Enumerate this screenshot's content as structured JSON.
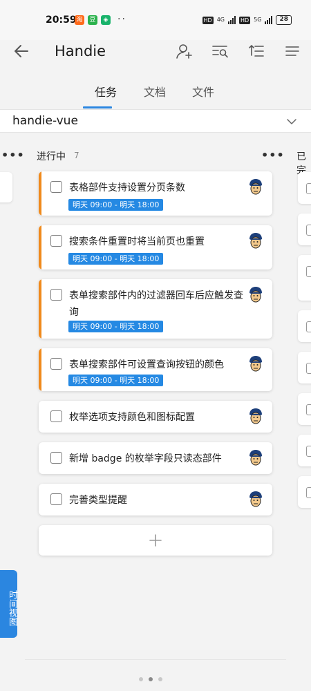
{
  "status_bar": {
    "time": "20:59",
    "network_1": "4G",
    "network_2": "5G",
    "hd_1": "HD",
    "hd_2": "HD",
    "battery": "28",
    "notification_icons": [
      "taobao-icon",
      "douban-icon",
      "vpn-icon"
    ],
    "dots": "··"
  },
  "header": {
    "title": "Handie",
    "icons": [
      "back-arrow-icon",
      "add-member-icon",
      "filter-search-icon",
      "sort-list-icon",
      "menu-icon"
    ]
  },
  "tabs": [
    {
      "label": "任务",
      "active": true
    },
    {
      "label": "文档",
      "active": false
    },
    {
      "label": "文件",
      "active": false
    }
  ],
  "project": {
    "name": "handie-vue"
  },
  "columns": {
    "in_progress": {
      "title": "进行中",
      "count": "7",
      "more": "•••"
    },
    "done": {
      "title": "已完"
    },
    "left_more": "•••"
  },
  "cards": [
    {
      "title": "表格部件支持设置分页条数",
      "time": "明天 09:00 - 明天 18:00",
      "accent": true
    },
    {
      "title": "搜索条件重置时将当前页也重置",
      "time": "明天 09:00 - 明天 18:00",
      "accent": true
    },
    {
      "title": "表单搜索部件内的过滤器回车后应触发查询",
      "time": "明天 09:00 - 明天 18:00",
      "accent": true
    },
    {
      "title": "表单搜索部件可设置查询按钮的颜色",
      "time": "明天 09:00 - 明天 18:00",
      "accent": true
    },
    {
      "title": "枚举选项支持颜色和图标配置",
      "time": "",
      "accent": false
    },
    {
      "title": "新增 badge 的枚举字段只读态部件",
      "time": "",
      "accent": false
    },
    {
      "title": "完善类型提醒",
      "time": "",
      "accent": false
    }
  ],
  "add_button": {
    "icon": "plus-icon"
  },
  "timeline_button": {
    "label": "时间视图"
  },
  "pager": {
    "pages": 3,
    "current": 2
  },
  "colors": {
    "primary": "#2b86e0",
    "tag": "#2589e3",
    "accent": "#f08a1c",
    "background": "#f3f3f3"
  }
}
